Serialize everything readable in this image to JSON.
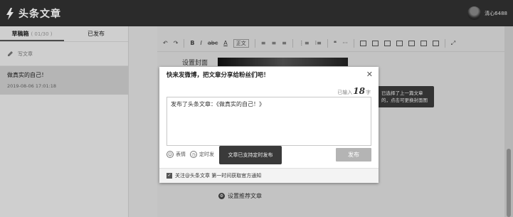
{
  "header": {
    "logo_text": "头条文章",
    "username": "清心6488"
  },
  "sidebar": {
    "tabs": [
      {
        "label": "草稿箱",
        "count": "( 01/30 )"
      },
      {
        "label": "已发布"
      }
    ],
    "write_label": "写文章",
    "draft": {
      "title": "做真实的自己！",
      "time": "2019-08-06 17:01:18"
    }
  },
  "editor": {
    "toolbar": {
      "undo": "↶",
      "redo": "↷",
      "bold": "B",
      "italic": "I",
      "strike": "abc",
      "font_color": "A",
      "font_select": "正文",
      "align_left": "≡",
      "align_center": "≡",
      "align_right": "≡",
      "ol": "⋮≡",
      "ul": "⁝≡",
      "quote": "❝",
      "more": "···",
      "fullscreen": "⤢"
    },
    "cover_label": "设置封面",
    "cover_tip": "已选择了上一篇文章的，点击可更换封面图",
    "recommend_label": "设置推荐文章"
  },
  "modal": {
    "title": "快来发微博，把文章分享给粉丝们吧！",
    "close": "✕",
    "counter_prefix": "已输入",
    "counter_value": "18",
    "counter_suffix": "字",
    "text": "发布了头条文章：《做真实的自己！》",
    "emoji_label": "表情",
    "schedule_label": "定时发",
    "tooltip": "文章已支持定时发布",
    "publish_label": "发布",
    "footer_check": "✓",
    "footer_text": "关注@头条文章 第一时间获取官方通知"
  }
}
